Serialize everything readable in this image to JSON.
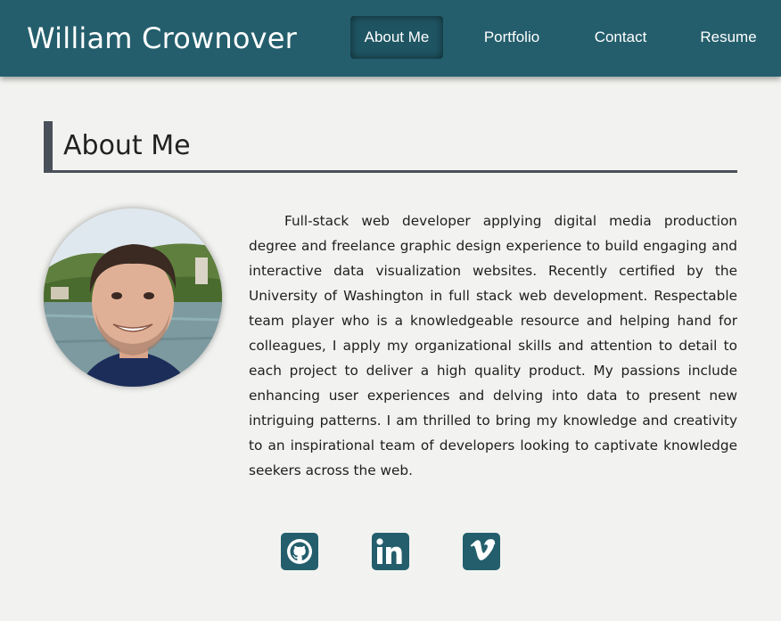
{
  "header": {
    "title": "William Crownover",
    "nav": [
      {
        "label": "About Me",
        "active": true
      },
      {
        "label": "Portfolio",
        "active": false
      },
      {
        "label": "Contact",
        "active": false
      },
      {
        "label": "Resume",
        "active": false
      }
    ]
  },
  "main": {
    "heading": "About Me",
    "avatar_icon": "profile-photo",
    "bio": "Full-stack web developer applying digital media production degree and freelance graphic design experience to build engaging and interactive data visualization websites. Recently certified by the University of Washington in full stack web development. Respectable team player who is a knowledgeable resource and helping hand for colleagues, I apply my organizational skills and attention to detail to each project to deliver a high quality product. My passions include enhancing user experiences and delving into data to present new intriguing patterns. I am thrilled to bring my knowledge and creativity to an inspirational team of developers looking to captivate knowledge seekers across the web."
  },
  "social": [
    {
      "icon": "github-icon"
    },
    {
      "icon": "linkedin-icon"
    },
    {
      "icon": "vimeo-icon"
    }
  ],
  "colors": {
    "brand": "#245e6c",
    "background": "#f2f3f0",
    "heading_border": "#4a505a"
  }
}
